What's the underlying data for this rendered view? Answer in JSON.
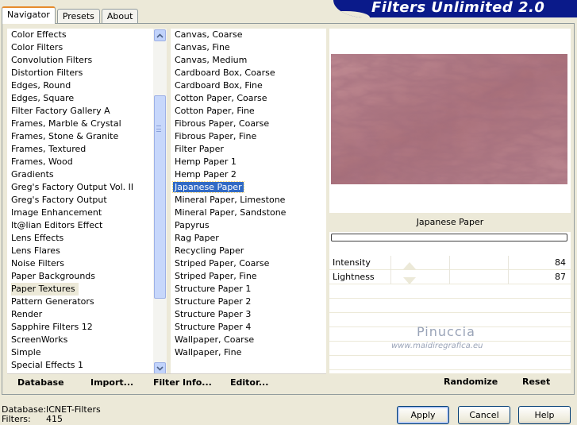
{
  "header": {
    "title": "Filters Unlimited 2.0"
  },
  "tabs": [
    {
      "label": "Navigator",
      "active": true
    },
    {
      "label": "Presets",
      "active": false
    },
    {
      "label": "About",
      "active": false
    }
  ],
  "categories": {
    "items": [
      "Color Effects",
      "Color Filters",
      "Convolution Filters",
      "Distortion Filters",
      "Edges, Round",
      "Edges, Square",
      "Filter Factory Gallery A",
      "Frames, Marble & Crystal",
      "Frames, Stone & Granite",
      "Frames, Textured",
      "Frames, Wood",
      "Gradients",
      "Greg's Factory Output Vol. II",
      "Greg's Factory Output",
      "Image Enhancement",
      "It@lian Editors Effect",
      "Lens Effects",
      "Lens Flares",
      "Noise Filters",
      "Paper Backgrounds",
      "Paper Textures",
      "Pattern Generators",
      "Render",
      "Sapphire Filters 12",
      "ScreenWorks",
      "Simple",
      "Special Effects 1"
    ],
    "selected_index": 20
  },
  "filters": {
    "items": [
      "Canvas, Coarse",
      "Canvas, Fine",
      "Canvas, Medium",
      "Cardboard Box, Coarse",
      "Cardboard Box, Fine",
      "Cotton Paper, Coarse",
      "Cotton Paper, Fine",
      "Fibrous Paper, Coarse",
      "Fibrous Paper, Fine",
      "Filter Paper",
      "Hemp Paper 1",
      "Hemp Paper 2",
      "Japanese Paper",
      "Mineral Paper, Limestone",
      "Mineral Paper, Sandstone",
      "Papyrus",
      "Rag Paper",
      "Recycling Paper",
      "Striped Paper, Coarse",
      "Striped Paper, Fine",
      "Structure Paper 1",
      "Structure Paper 2",
      "Structure Paper 3",
      "Structure Paper 4",
      "Wallpaper, Coarse",
      "Wallpaper, Fine"
    ],
    "selected_index": 12
  },
  "toolbar": {
    "database": "Database",
    "import": "Import...",
    "filter_info": "Filter Info...",
    "editor": "Editor..."
  },
  "preview": {
    "filter_name": "Japanese Paper",
    "params": [
      {
        "label": "Intensity",
        "value": "84"
      },
      {
        "label": "Lightness",
        "value": "87"
      }
    ],
    "watermark_name": "Pinuccia",
    "watermark_site": "www.maidiregrafica.eu",
    "randomize": "Randomize",
    "reset": "Reset"
  },
  "status": {
    "database_label": "Database:",
    "database_value": "ICNET-Filters",
    "filters_label": "Filters:",
    "filters_value": "415"
  },
  "buttons": {
    "apply": "Apply",
    "cancel": "Cancel",
    "help": "Help"
  },
  "colors": {
    "banner": "#0a1a8a",
    "selection": "#316ac5",
    "preview_tone": "#b37a82"
  }
}
